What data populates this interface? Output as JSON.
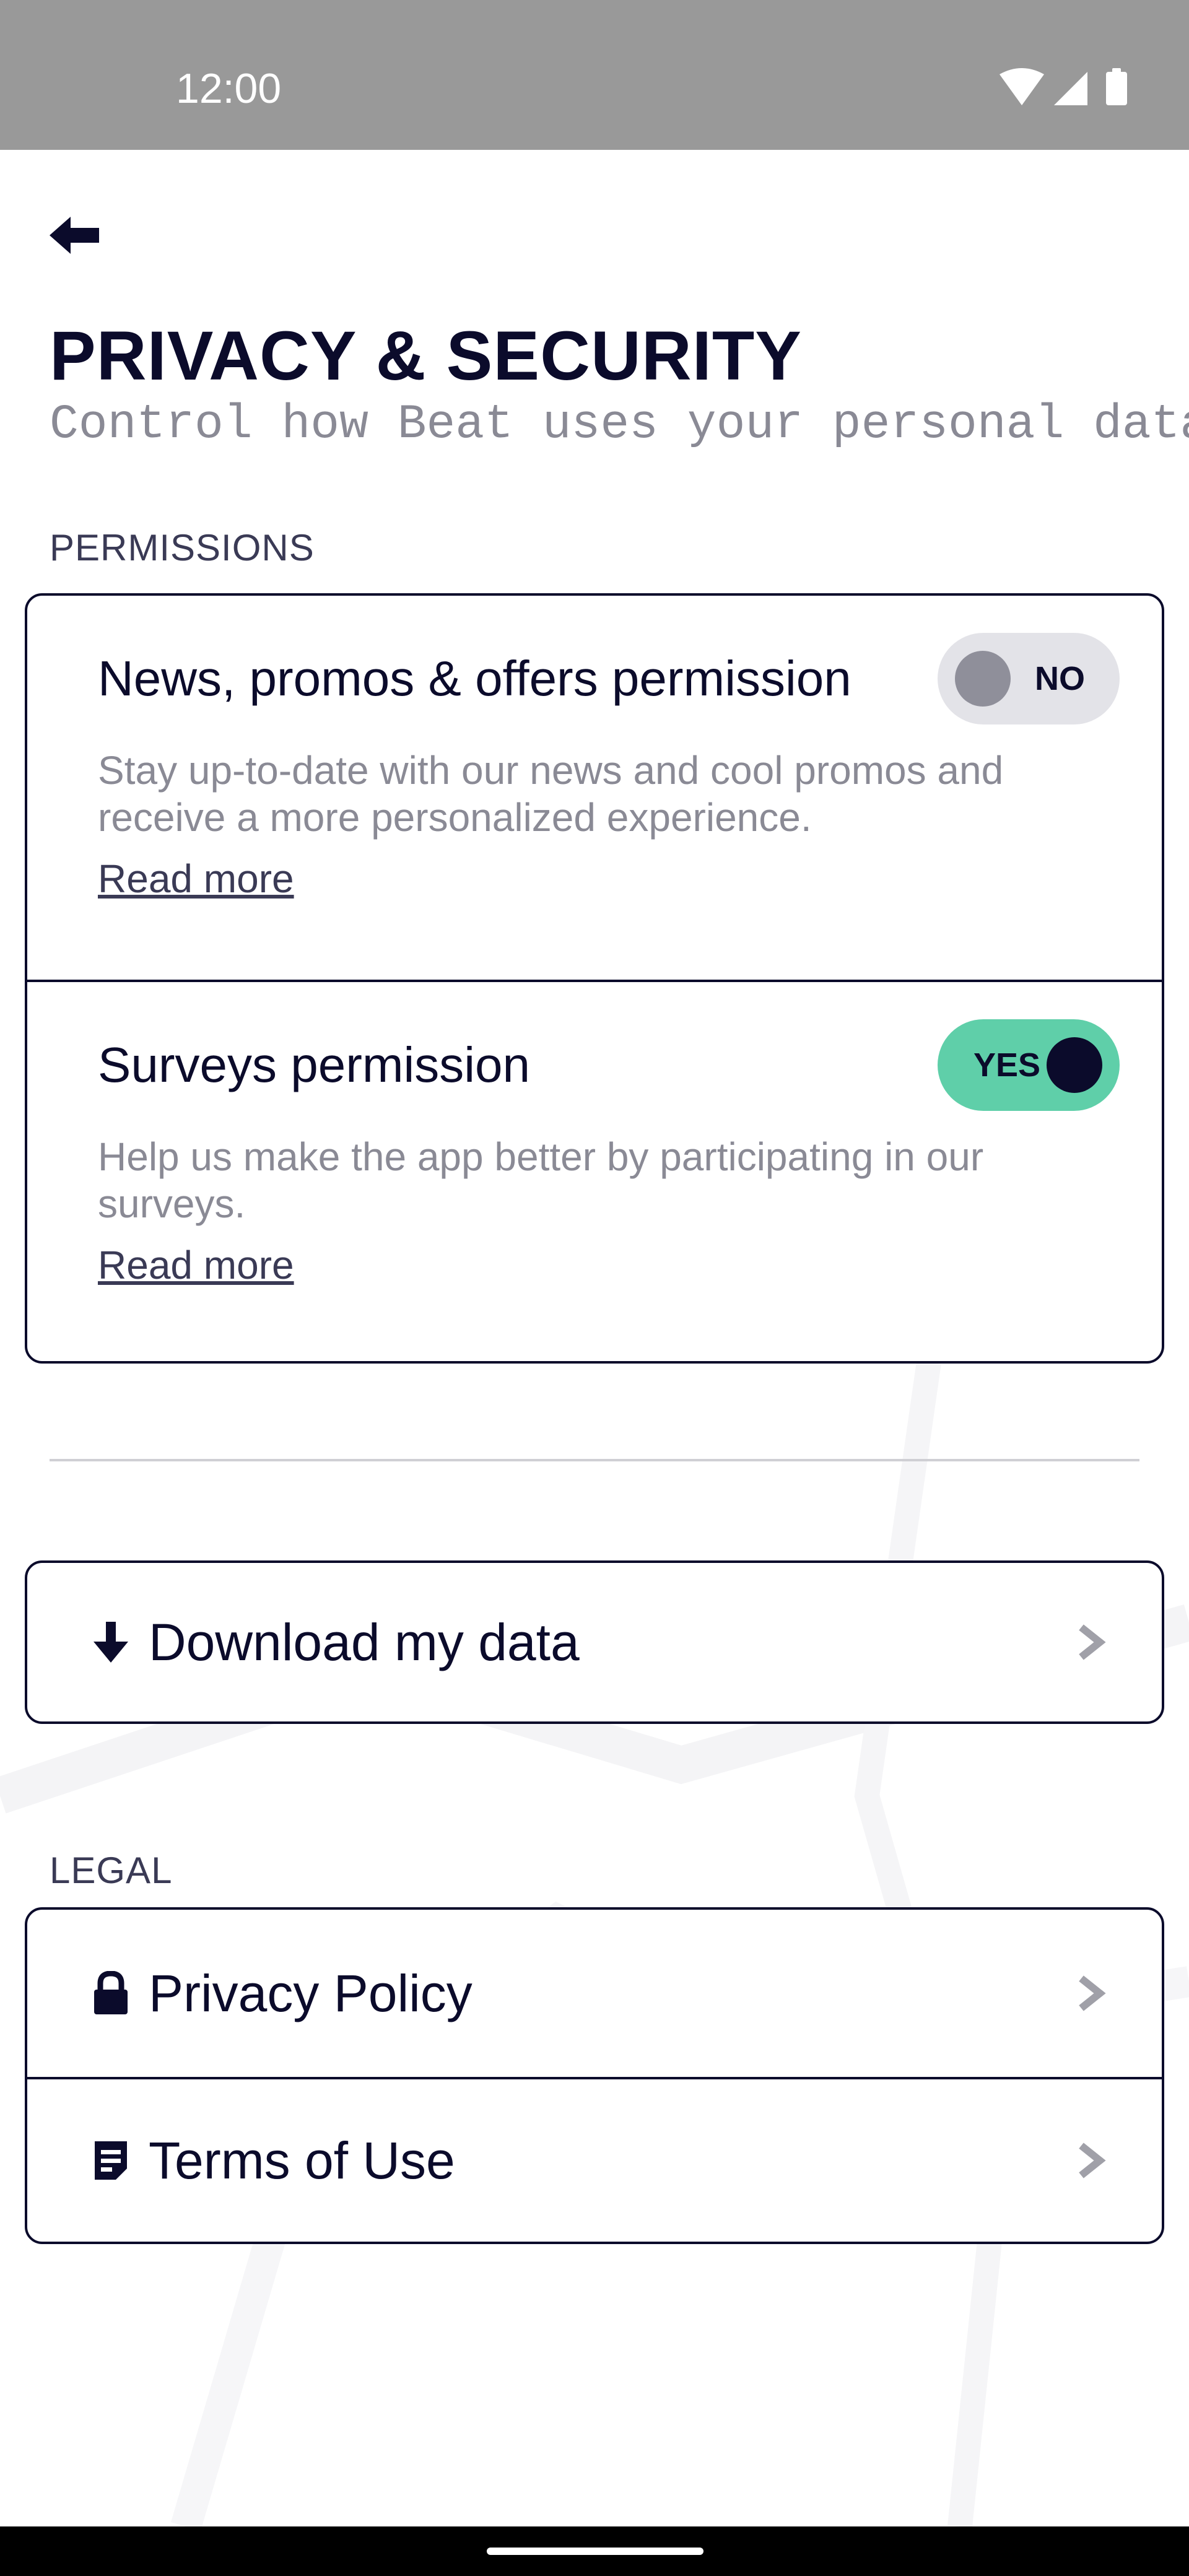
{
  "status_bar": {
    "time": "12:00"
  },
  "header": {
    "title": "PRIVACY & SECURITY",
    "subtitle": "Control how Beat uses your personal data."
  },
  "permissions": {
    "section_label": "PERMISSIONS",
    "items": [
      {
        "title": "News, promos & offers permission",
        "description": "Stay up-to-date with our news and cool promos and receive a more personalized experience.",
        "read_more": "Read more",
        "toggle_label": "NO",
        "enabled": false
      },
      {
        "title": "Surveys permission",
        "description": "Help us make the app better by participating in our surveys.",
        "read_more": "Read more",
        "toggle_label": "YES",
        "enabled": true
      }
    ]
  },
  "data": {
    "download_label": "Download my data"
  },
  "legal": {
    "section_label": "LEGAL",
    "items": [
      {
        "label": "Privacy Policy",
        "icon": "lock-icon"
      },
      {
        "label": "Terms of Use",
        "icon": "document-icon"
      }
    ]
  },
  "colors": {
    "primary": "#0b0b2b",
    "toggle_on": "#5fcfa9",
    "toggle_off": "#e3e3e8",
    "muted_text": "#8a8a95",
    "status_bar": "#999999"
  }
}
